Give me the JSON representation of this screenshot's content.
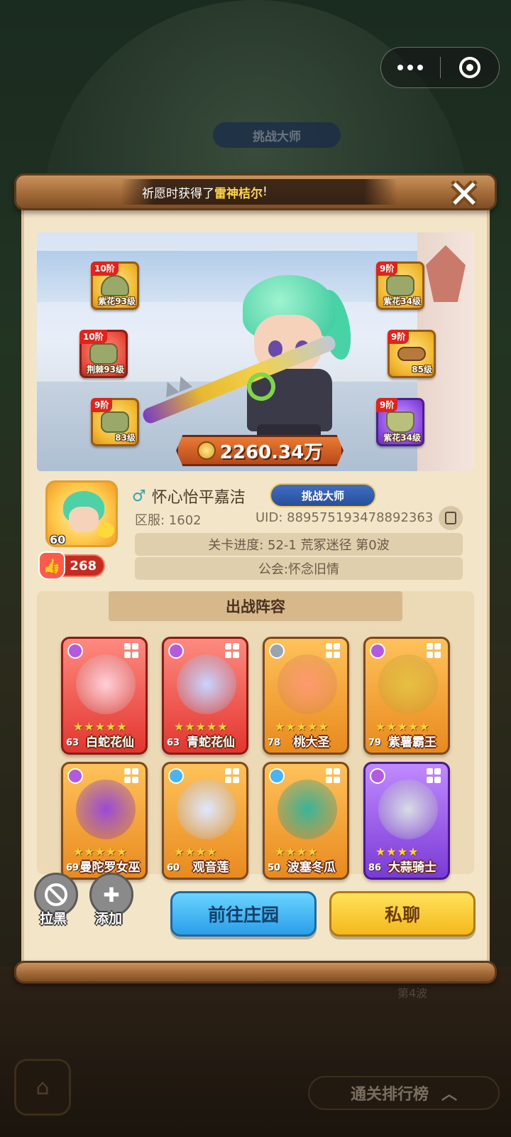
{
  "background": {
    "badge": "挑战大师",
    "rank_button": "通关排行榜",
    "wave_text": "第4波"
  },
  "notice": {
    "prefix": "祈愿时获得了",
    "highlight": "雷神桔尔",
    "suffix": "!"
  },
  "equipment": [
    {
      "tier": "10阶",
      "level": "紫花93级",
      "color": "gold",
      "icon": "hat-icon"
    },
    {
      "tier": "10阶",
      "level": "荆棘93级",
      "color": "red",
      "icon": "glove-icon"
    },
    {
      "tier": "9阶",
      "level": "83级",
      "color": "gold",
      "icon": "pants-icon"
    },
    {
      "tier": "9阶",
      "level": "紫花34级",
      "color": "gold",
      "icon": "armor-icon"
    },
    {
      "tier": "9阶",
      "level": "85级",
      "color": "gold",
      "icon": "belt-icon"
    },
    {
      "tier": "9阶",
      "level": "紫花34级",
      "color": "purple",
      "icon": "boots-icon"
    }
  ],
  "power": "2260.34万",
  "player": {
    "level": "60",
    "likes": "268",
    "gender_symbol": "♂",
    "name": "怀心怡平嘉洁",
    "title_badge": "挑战大师",
    "server": "区服: 1602",
    "uid": "UID: 889575193478892363",
    "stage": "关卡进度: 52-1  荒冢迷径  第0波",
    "guild": "公会:怀念旧情"
  },
  "lineup": {
    "title": "出战阵容",
    "cards": [
      {
        "name": "白蛇花仙",
        "level": "63",
        "stars": "★★★★★",
        "color": "red",
        "element": "#b45ae0"
      },
      {
        "name": "青蛇花仙",
        "level": "63",
        "stars": "★★★★★",
        "color": "red",
        "element": "#b45ae0"
      },
      {
        "name": "桃大圣",
        "level": "78",
        "stars": "★★★★★",
        "color": "orange",
        "element": "#9aa4b0"
      },
      {
        "name": "紫薯霸王",
        "level": "79",
        "stars": "★★★★★",
        "color": "orange",
        "element": "#b45ae0"
      },
      {
        "name": "曼陀罗女巫",
        "level": "69",
        "stars": "★★★★★",
        "color": "orange",
        "element": "#b45ae0"
      },
      {
        "name": "观音莲",
        "level": "60",
        "stars": "★★★★",
        "color": "orange",
        "element": "#4ab4f0"
      },
      {
        "name": "波塞冬瓜",
        "level": "50",
        "stars": "★★★★",
        "color": "orange",
        "element": "#4ab4f0"
      },
      {
        "name": "大蒜骑士",
        "level": "86",
        "stars": "★★★★",
        "color": "purple",
        "element": "#b45ae0"
      }
    ]
  },
  "actions": {
    "block": "拉黑",
    "add": "添加",
    "visit": "前往庄园",
    "chat": "私聊"
  }
}
